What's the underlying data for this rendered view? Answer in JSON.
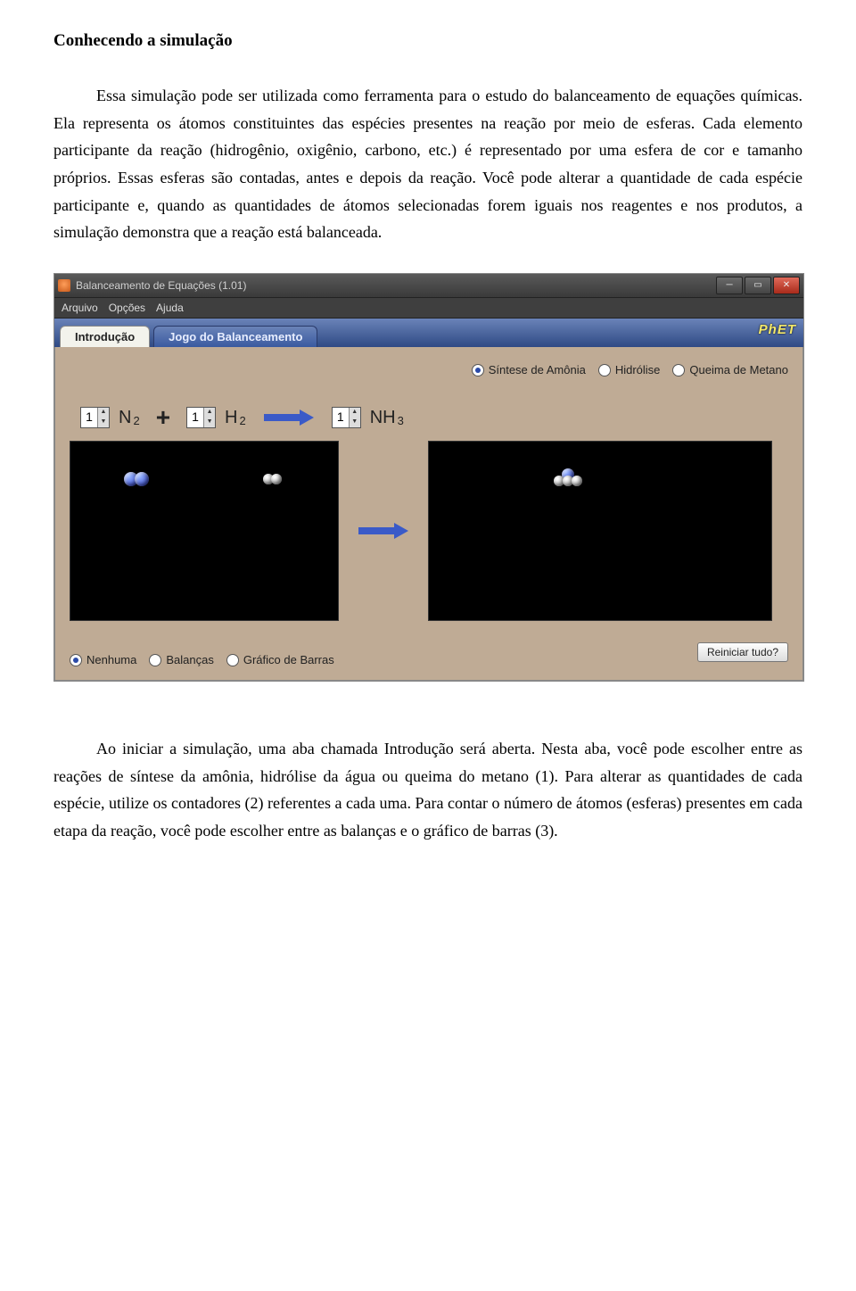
{
  "heading": "Conhecendo a simulação",
  "para1": "Essa simulação pode ser utilizada como ferramenta para o estudo do balanceamento de equações químicas. Ela representa os átomos constituintes das espécies presentes na reação por meio de esferas. Cada elemento participante da reação (hidrogênio, oxigênio, carbono, etc.) é representado por uma esfera de cor e tamanho próprios. Essas esferas são contadas, antes e depois da reação. Você pode alterar a quantidade de cada espécie participante e, quando as quantidades de átomos selecionadas forem iguais nos reagentes e nos produtos, a simulação demonstra que a reação está balanceada.",
  "para2": "Ao iniciar a simulação, uma aba chamada Introdução será aberta. Nesta aba, você pode escolher entre as reações de síntese da amônia, hidrólise da água ou queima do metano (1). Para alterar as quantidades de cada espécie, utilize os contadores (2) referentes a cada uma. Para contar o número de átomos (esferas) presentes em cada etapa da reação, você pode escolher entre as balanças e o gráfico de barras (3).",
  "app": {
    "title": "Balanceamento de Equações (1.01)",
    "menu": {
      "file": "Arquivo",
      "options": "Opções",
      "help": "Ajuda"
    },
    "tabs": {
      "intro": "Introdução",
      "game": "Jogo do Balanceamento"
    },
    "phet": "PhET",
    "reactions": {
      "ammonia": "Síntese de Amônia",
      "hydrolysis": "Hidrólise",
      "methane": "Queima de Metano",
      "selected": "ammonia"
    },
    "equation": {
      "c1": "1",
      "f1_main": "N",
      "f1_sub": "2",
      "plus": "+",
      "c2": "1",
      "f2_main": "H",
      "f2_sub": "2",
      "c3": "1",
      "f3_main": "NH",
      "f3_sub": "3"
    },
    "views": {
      "none": "Nenhuma",
      "scales": "Balanças",
      "bars": "Gráfico de Barras",
      "selected": "none"
    },
    "reset": "Reiniciar tudo?"
  }
}
